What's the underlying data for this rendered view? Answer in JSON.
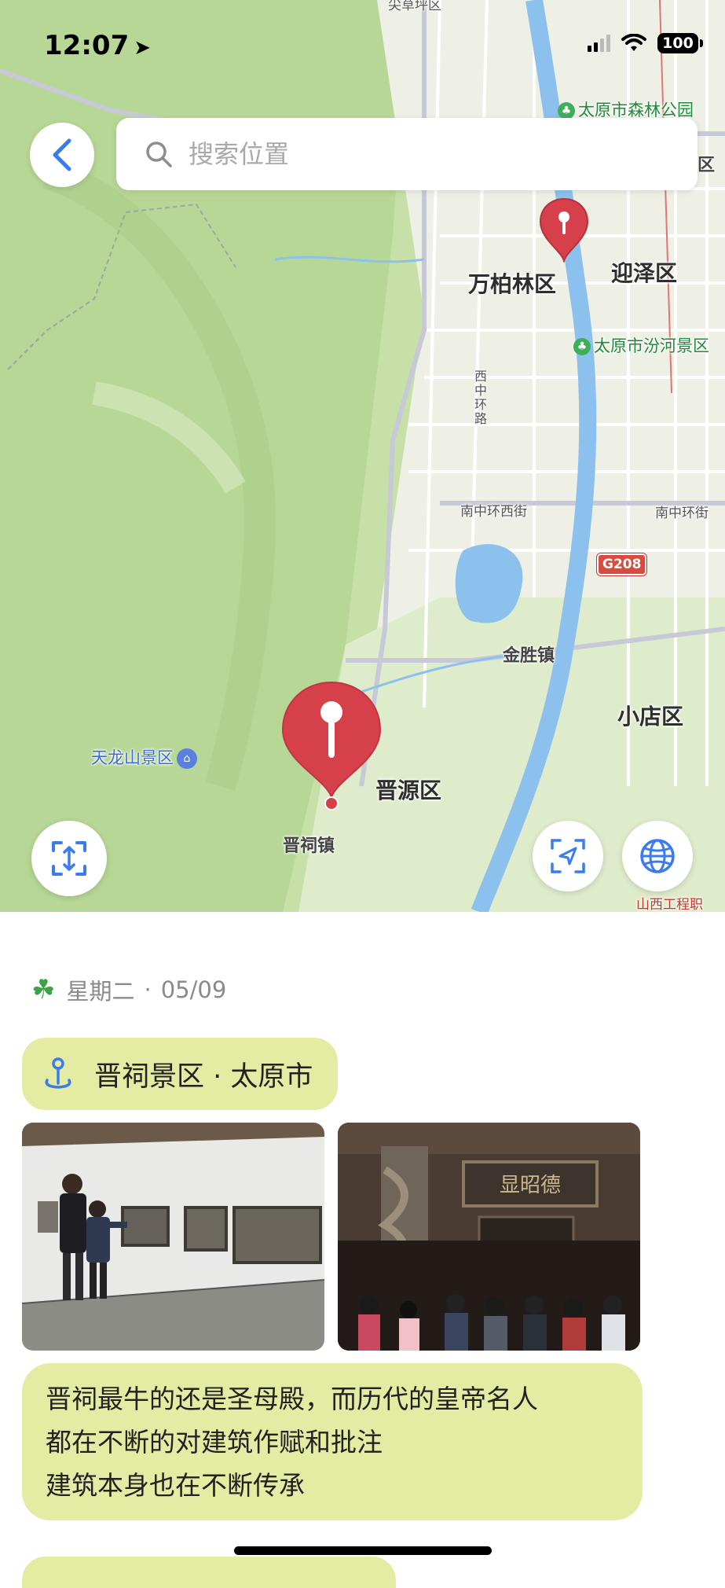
{
  "status_bar": {
    "time": "12:07",
    "battery": "100"
  },
  "search": {
    "placeholder": "搜索位置"
  },
  "map": {
    "labels": {
      "district_wanbailin": "万柏林区",
      "district_yingze": "迎泽区",
      "district_jinyuan": "晋源区",
      "district_xiaodian": "小店区",
      "town_jinsheng": "金胜镇",
      "town_jinci": "晋祠镇",
      "park_forest": "太原市森林公园",
      "park_fenhe": "太原市汾河景区",
      "scenic_tianlong": "天龙山景区",
      "road_nanzhonghuan_west": "南中环西街",
      "road_nanzhonghuan": "南中环街",
      "road_xizhonghuan": "西中环路",
      "road_g208": "G208",
      "top_cut_label": "尖草坪区",
      "right_cut_label": "区",
      "bottom_right_cut": "山西工程职"
    }
  },
  "entry": {
    "weekday": "星期二",
    "separator": "·",
    "date": "05/09",
    "location": "晋祠景区 · 太原市",
    "note_lines": [
      "晋祠最牛的还是圣母殿，而历代的皇帝名人",
      "都在不断的对建筑作赋和批注",
      "建筑本身也在不断传承"
    ]
  },
  "colors": {
    "chip_bg": "#e4eca4",
    "pin_red": "#d6404a",
    "accent_blue": "#3b7bf0"
  }
}
